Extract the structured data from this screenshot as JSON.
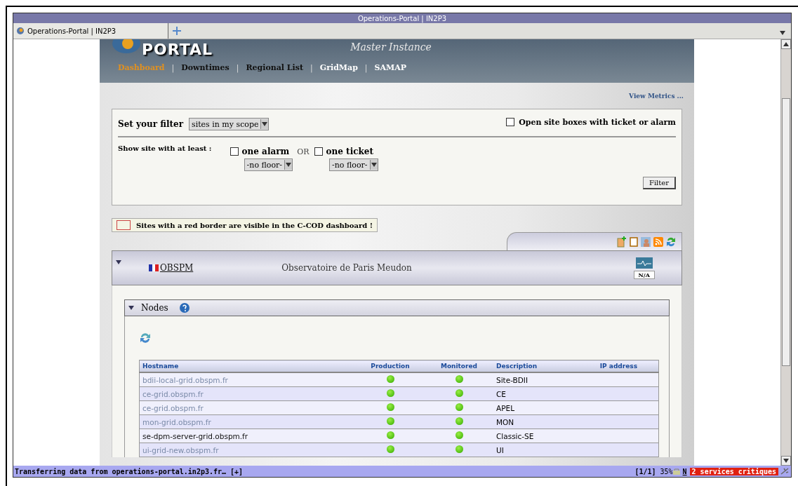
{
  "window": {
    "title": "Operations-Portal | IN2P3"
  },
  "tabs": [
    {
      "label": "Operations-Portal | IN2P3",
      "selected": true
    }
  ],
  "header": {
    "logo_text": "PORTAL",
    "instance": "Master Instance"
  },
  "nav": [
    {
      "label": "Dashboard",
      "selected": true
    },
    {
      "label": "Downtimes",
      "selected": false
    },
    {
      "label": "Regional List",
      "selected": false
    },
    {
      "label": "GridMap",
      "selected": false
    },
    {
      "label": "SAMAP",
      "selected": false
    }
  ],
  "nav_separator": "|",
  "view_metrics": "View Metrics ...",
  "filter": {
    "label": "Set your filter",
    "scope": "sites in my scope",
    "open_boxes": {
      "label": "Open site boxes with ticket or alarm",
      "checked": false
    },
    "show_label": "Show site with at least :",
    "alarm": {
      "label": "one alarm",
      "checked": false,
      "floor": "-no floor-"
    },
    "or": "OR",
    "ticket": {
      "label": "one ticket",
      "checked": false,
      "floor": "-no floor-"
    },
    "button": "Filter"
  },
  "notice": "Sites with a red border are visible in the C-COD dashboard !",
  "site": {
    "expanded": true,
    "name": "OBSPM",
    "full_name": "Observatoire de Paris Meudon",
    "status": "N/A"
  },
  "nodes": {
    "title": "Nodes",
    "expanded": true,
    "columns": [
      "Hostname",
      "Production",
      "Monitored",
      "Description",
      "IP address"
    ],
    "rows": [
      {
        "hostname": "bdii-local-grid.obspm.fr",
        "kind": "visited",
        "production": true,
        "monitored": true,
        "description": "Site-BDII"
      },
      {
        "hostname": "ce-grid.obspm.fr",
        "kind": "visited",
        "production": true,
        "monitored": true,
        "description": "CE"
      },
      {
        "hostname": "ce-grid.obspm.fr",
        "kind": "visited",
        "production": true,
        "monitored": true,
        "description": "APEL"
      },
      {
        "hostname": "mon-grid.obspm.fr",
        "kind": "visited",
        "production": true,
        "monitored": true,
        "description": "MON"
      },
      {
        "hostname": "se-dpm-server-grid.obspm.fr",
        "kind": "plain",
        "production": true,
        "monitored": true,
        "description": "Classic-SE"
      },
      {
        "hostname": "ui-grid-new.obspm.fr",
        "kind": "visited",
        "production": true,
        "monitored": true,
        "description": "UI"
      }
    ]
  },
  "status_bar": {
    "message": "Transferring data from operations-portal.in2p3.fr… [+]",
    "pages": "[1/1]",
    "zoom": "35%",
    "n": "N",
    "alert": "2 services critiques"
  }
}
